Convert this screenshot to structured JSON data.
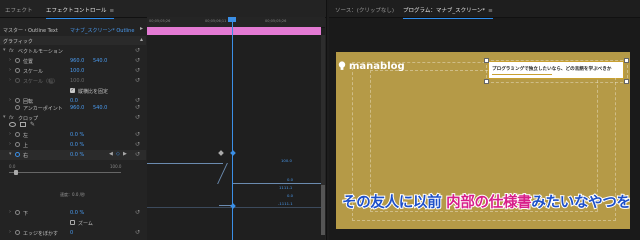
{
  "left_panel": {
    "tabs": [
      {
        "label": "エフェクト",
        "active": false
      },
      {
        "label": "エフェクトコントロール",
        "active": true
      }
    ],
    "tab_menu": "≡",
    "source_row": {
      "label": "マスター・Outline Text",
      "clip": "マナブ_スクリーン* Outline"
    },
    "timeline_ruler": [
      "00;05;05;26",
      "00;05;06;11",
      "00;05;05;26"
    ],
    "header": "グラフィック",
    "rows": [
      {
        "label": "ベクトルモーション",
        "indent": 1,
        "type": "group"
      },
      {
        "label": "位置",
        "indent": 2,
        "value": "960.0",
        "value2": "540.0"
      },
      {
        "label": "スケール",
        "indent": 2,
        "value": "100.0"
      },
      {
        "label": "スケール（幅）",
        "indent": 2,
        "value": "100.0",
        "dim": true
      },
      {
        "label": "縦横比を固定",
        "indent": 3,
        "checkbox": true
      },
      {
        "label": "回転",
        "indent": 2,
        "value": "0.0"
      },
      {
        "label": "アンカーポイント",
        "indent": 2,
        "value": "960.0",
        "value2": "540.0"
      },
      {
        "label": "クロップ",
        "indent": 1,
        "type": "group"
      },
      {
        "label": "左",
        "indent": 2,
        "value": "0.0 %"
      },
      {
        "label": "上",
        "indent": 2,
        "value": "0.0 %"
      },
      {
        "label": "右",
        "indent": 2,
        "value": "0.0 %",
        "keyframe": true
      },
      {
        "label": "",
        "indent": 2,
        "graph": true,
        "range_top": "0.0",
        "range_top_r": "100.0"
      },
      {
        "label": "",
        "indent": 2,
        "speed_label": "速度：0.0 /秒"
      },
      {
        "label": "下",
        "indent": 2,
        "value": "0.0 %"
      },
      {
        "label": "ズーム",
        "indent": 3,
        "checkbox": true
      },
      {
        "label": "エッジをぼかす",
        "indent": 2,
        "value": "0"
      }
    ],
    "graph_values": [
      "100.0",
      "0.0",
      "1111.1",
      "0.0",
      "-1111.1"
    ]
  },
  "right_panel": {
    "tabs": [
      {
        "label": "ソース：(クリップなし)",
        "active": false
      },
      {
        "label": "プログラム：マナブ_スクリーン*",
        "active": true
      }
    ],
    "tab_menu": "≡"
  },
  "program": {
    "logo": "manablog",
    "header_text": "プログラミングで独立したいなら、どの言語を学ぶべきか",
    "subtitle_blue1": "その友人に以前",
    "subtitle_pink": "内部の仕様書",
    "subtitle_blue2": "みたいなやつを",
    "colors": {
      "background": "#b59a47",
      "subtitle_blue": "#1e50c8",
      "subtitle_pink": "#d81f8a",
      "header_border": "#c9a030"
    }
  }
}
